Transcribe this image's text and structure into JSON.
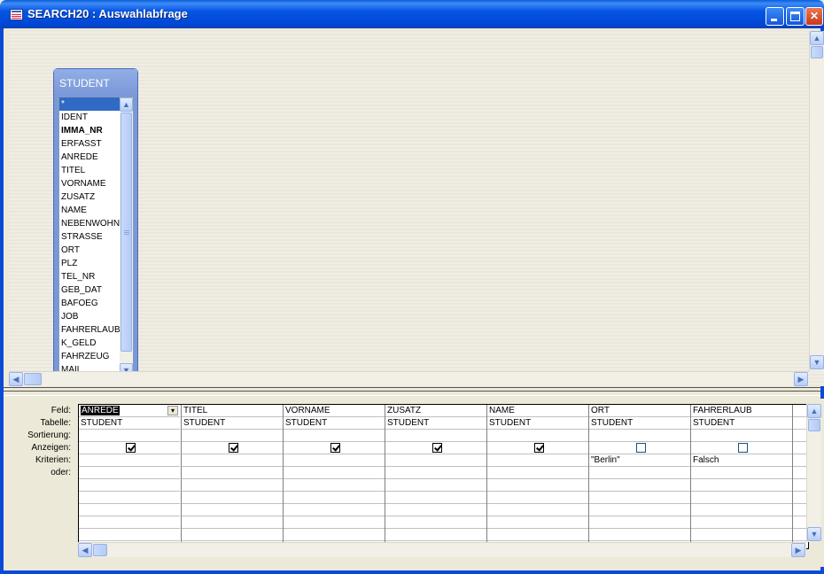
{
  "window": {
    "title": "SEARCH20 : Auswahlabfrage"
  },
  "table_box": {
    "title": "STUDENT",
    "fields": [
      "*",
      "IDENT",
      "IMMA_NR",
      "ERFASST",
      "ANREDE",
      "TITEL",
      "VORNAME",
      "ZUSATZ",
      "NAME",
      "NEBENWOHN",
      "STRASSE",
      "ORT",
      "PLZ",
      "TEL_NR",
      "GEB_DAT",
      "BAFOEG",
      "JOB",
      "FAHRERLAUB",
      "K_GELD",
      "FAHRZEUG",
      "MAIL"
    ],
    "selected_field": "*",
    "bold_field": "IMMA_NR"
  },
  "grid": {
    "row_labels": {
      "feld": "Feld:",
      "tabelle": "Tabelle:",
      "sortierung": "Sortierung:",
      "anzeigen": "Anzeigen:",
      "kriterien": "Kriterien:",
      "oder": "oder:"
    },
    "columns": [
      {
        "feld": "ANREDE",
        "tabelle": "STUDENT",
        "sortierung": "",
        "anzeigen": true,
        "kriterien": "",
        "oder": ""
      },
      {
        "feld": "TITEL",
        "tabelle": "STUDENT",
        "sortierung": "",
        "anzeigen": true,
        "kriterien": "",
        "oder": ""
      },
      {
        "feld": "VORNAME",
        "tabelle": "STUDENT",
        "sortierung": "",
        "anzeigen": true,
        "kriterien": "",
        "oder": ""
      },
      {
        "feld": "ZUSATZ",
        "tabelle": "STUDENT",
        "sortierung": "",
        "anzeigen": true,
        "kriterien": "",
        "oder": ""
      },
      {
        "feld": "NAME",
        "tabelle": "STUDENT",
        "sortierung": "",
        "anzeigen": true,
        "kriterien": "",
        "oder": ""
      },
      {
        "feld": "ORT",
        "tabelle": "STUDENT",
        "sortierung": "",
        "anzeigen": false,
        "kriterien": "\"Berlin\"",
        "oder": ""
      },
      {
        "feld": "FAHRERLAUB",
        "tabelle": "STUDENT",
        "sortierung": "",
        "anzeigen": false,
        "kriterien": "Falsch",
        "oder": ""
      }
    ]
  },
  "colors": {
    "title_bar": "#0554e3",
    "selection": "#316ac5",
    "table_box": "#7a98d8"
  }
}
